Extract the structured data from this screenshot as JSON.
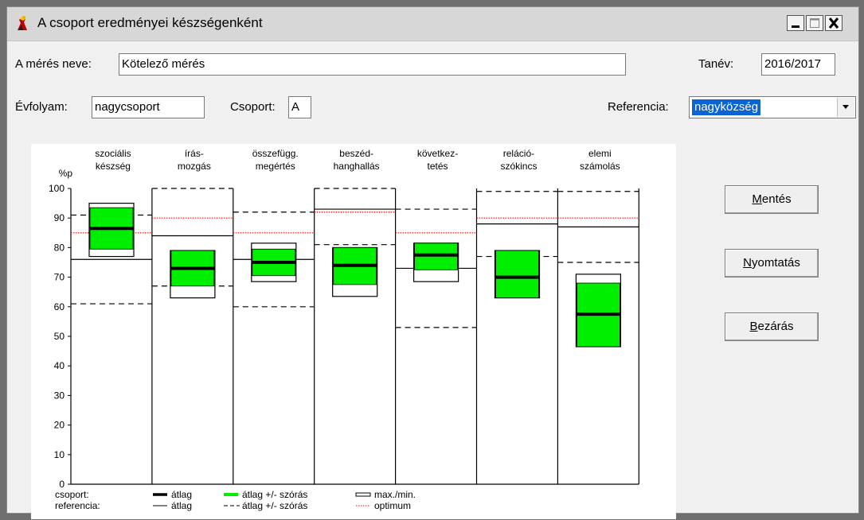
{
  "window": {
    "title": "A csoport eredményei készségenként",
    "controls": [
      "minimize",
      "maximize",
      "close"
    ],
    "icon": "app-figure-icon"
  },
  "form": {
    "measurement_label": "A mérés neve:",
    "measurement_value": "Kötelező mérés",
    "school_year_label": "Tanév:",
    "school_year_value": "2016/2017",
    "grade_label": "Évfolyam:",
    "grade_value": "nagycsoport",
    "group_label": "Csoport:",
    "group_value": "A",
    "reference_label": "Referencia:",
    "reference_value": "nagyközség"
  },
  "buttons": {
    "save": {
      "label": "Mentés",
      "hotkey": "M",
      "rest": "entés"
    },
    "print": {
      "label": "Nyomtatás",
      "hotkey": "N",
      "rest": "yomtatás"
    },
    "close": {
      "label": "Bezárás",
      "hotkey": "B",
      "rest": "ezárás"
    }
  },
  "colors": {
    "accent": "#0a64d6",
    "band": "#00ee00",
    "optimum": "#ff0000"
  },
  "chart_data": {
    "type": "box",
    "ylabel": "%p",
    "ylim": [
      0,
      100
    ],
    "yticks": [
      0,
      10,
      20,
      30,
      40,
      50,
      60,
      70,
      80,
      90,
      100
    ],
    "categories": [
      {
        "line1": "szociális",
        "line2": "készség"
      },
      {
        "line1": "írás-",
        "line2": "mozgás"
      },
      {
        "line1": "összefügg.",
        "line2": "megértés"
      },
      {
        "line1": "beszéd-",
        "line2": "hanghallás"
      },
      {
        "line1": "következ-",
        "line2": "tetés"
      },
      {
        "line1": "reláció-",
        "line2": "szókincs"
      },
      {
        "line1": "elemi",
        "line2": "számolás"
      }
    ],
    "group": {
      "mean": [
        86.5,
        73,
        75,
        74,
        77.5,
        70,
        57.5
      ],
      "sd_low": [
        79.5,
        67,
        70.5,
        67.5,
        72.5,
        63,
        46.5
      ],
      "sd_high": [
        93.5,
        79,
        79.5,
        80,
        81.5,
        79,
        68
      ],
      "min": [
        77,
        63,
        68.5,
        63.5,
        68.5,
        63,
        46.5
      ],
      "max": [
        95,
        79,
        81.5,
        80,
        81.5,
        79,
        71
      ]
    },
    "reference": {
      "mean": [
        76,
        84,
        76,
        93,
        73,
        88,
        87
      ],
      "sd_low": [
        61,
        67,
        60,
        81,
        53,
        77,
        75
      ],
      "sd_high": [
        91,
        100,
        92,
        100,
        93,
        99,
        99
      ],
      "optimum": [
        85,
        90,
        85,
        92,
        85,
        90,
        90
      ]
    },
    "legend": {
      "group_label": "csoport:",
      "reference_label": "referencia:",
      "group_mean": "átlag",
      "group_sd": "átlag +/- szórás",
      "group_minmax": "max./min.",
      "ref_mean": "átlag",
      "ref_sd": "átlag +/- szórás",
      "ref_optimum": "optimum"
    }
  }
}
